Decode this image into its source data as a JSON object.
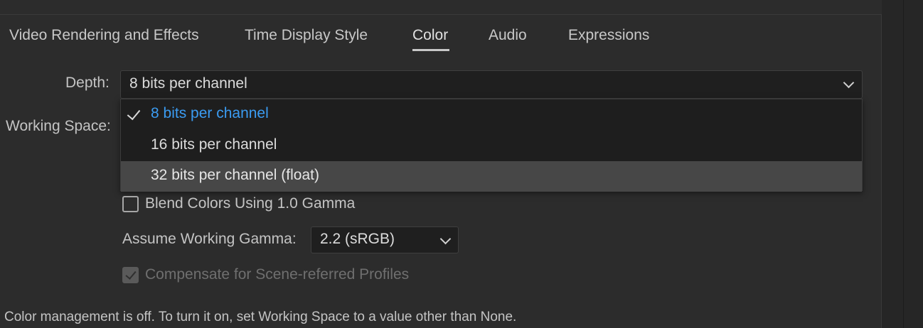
{
  "tabs": [
    {
      "label": "Video Rendering and Effects"
    },
    {
      "label": "Time Display Style"
    },
    {
      "label": "Color"
    },
    {
      "label": "Audio"
    },
    {
      "label": "Expressions"
    }
  ],
  "active_tab": "Color",
  "depth": {
    "label": "Depth:",
    "value": "8 bits per channel",
    "options": [
      {
        "label": "8 bits per channel",
        "selected": true
      },
      {
        "label": "16 bits per channel",
        "selected": false
      },
      {
        "label": "32 bits per channel (float)",
        "selected": false
      }
    ]
  },
  "working_space": {
    "label": "Working Space:"
  },
  "blend_colors": {
    "label": "Blend Colors Using 1.0 Gamma",
    "checked": false
  },
  "working_gamma": {
    "label": "Assume Working Gamma:",
    "value": "2.2 (sRGB)"
  },
  "compensate": {
    "label": "Compensate for Scene-referred Profiles",
    "checked": true,
    "enabled": false
  },
  "footer": {
    "message": "Color management is off. To turn it on, set Working Space to a value other than None."
  },
  "colors": {
    "accent": "#3b9cf2",
    "panel_bg": "#2c2c2c",
    "menu_bg": "#1e1e1e",
    "hover_bg": "#474747"
  }
}
